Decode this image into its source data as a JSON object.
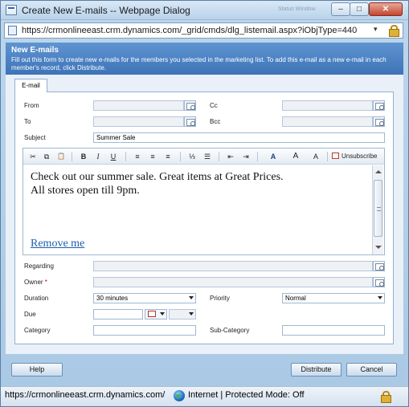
{
  "window": {
    "title": "Create New E-mails -- Webpage Dialog",
    "ghost_text": "Status Window",
    "minimize": "–",
    "maximize": "□",
    "close": "✕"
  },
  "address": {
    "url": "https://crmonlineeast.crm.dynamics.com/_grid/cmds/dlg_listemail.aspx?iObjType=440",
    "dropdown": "▾"
  },
  "header": {
    "title": "New E-mails",
    "description": "Fill out this form to create new e-mails for the members you selected in the marketing list. To add this e-mail as a new e-mail in each member's record, click Distribute."
  },
  "tab": {
    "label": "E-mail"
  },
  "form": {
    "from_label": "From",
    "cc_label": "Cc",
    "to_label": "To",
    "bcc_label": "Bcc",
    "subject_label": "Subject",
    "subject_value": "Summer Sale",
    "regarding_label": "Regarding",
    "owner_label": "Owner",
    "owner_required": "*",
    "duration_label": "Duration",
    "duration_value": "30 minutes",
    "priority_label": "Priority",
    "priority_value": "Normal",
    "due_label": "Due",
    "category_label": "Category",
    "subcategory_label": "Sub-Category"
  },
  "editor": {
    "toolbar": {
      "cut": "✂",
      "copy": "⧉",
      "paste": "📋",
      "bold": "B",
      "italic": "I",
      "underline": "U",
      "align_left": "≡",
      "align_center": "≡",
      "align_right": "≡",
      "numbered_list": "⅓",
      "bulleted_list": "☰",
      "outdent": "⇤",
      "indent": "⇥",
      "highlight": "A",
      "font_size": "A",
      "font_color": "A",
      "unsubscribe": "Unsubscribe"
    },
    "body_line1": "Check out our summer sale. Great items at Great Prices.",
    "body_line2": "All stores open till 9pm.",
    "remove_link": "Remove me"
  },
  "buttons": {
    "help": "Help",
    "distribute": "Distribute",
    "cancel": "Cancel"
  },
  "status": {
    "url": "https://crmonlineeast.crm.dynamics.com/",
    "zone": "Internet | Protected Mode: Off"
  }
}
